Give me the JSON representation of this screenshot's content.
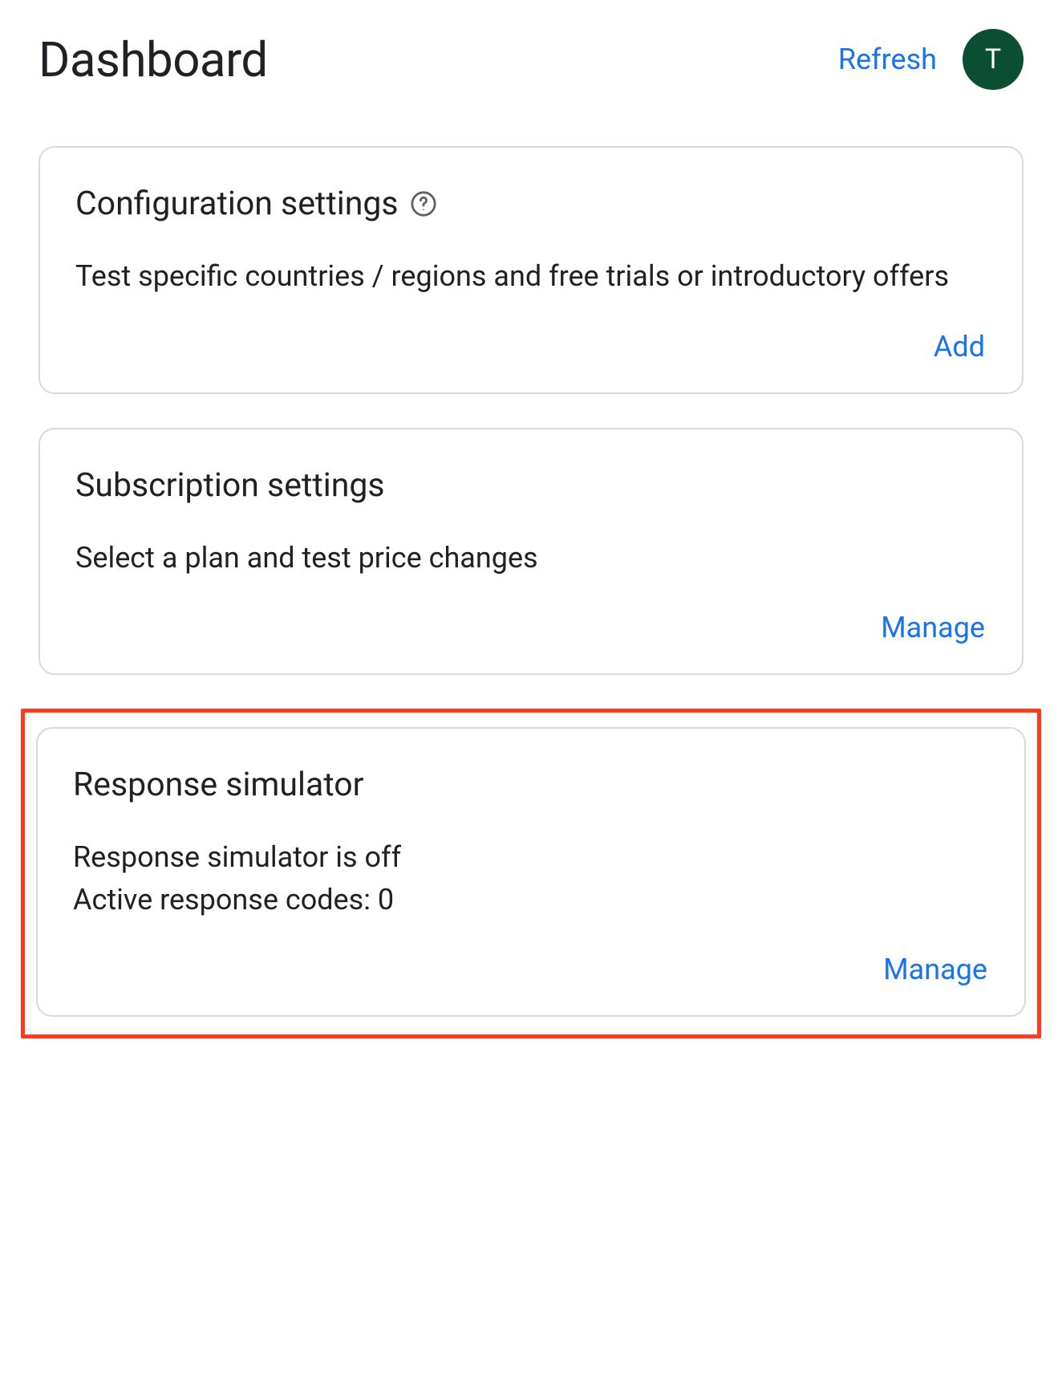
{
  "header": {
    "title": "Dashboard",
    "refresh_label": "Refresh",
    "avatar_letter": "T"
  },
  "cards": {
    "config": {
      "title": "Configuration settings",
      "desc": "Test specific countries / regions and free trials or introductory offers",
      "action": "Add"
    },
    "subscription": {
      "title": "Subscription settings",
      "desc": "Select a plan and test price changes",
      "action": "Manage"
    },
    "response": {
      "title": "Response simulator",
      "line1": "Response simulator is off",
      "line2": "Active response codes: 0",
      "action": "Manage"
    }
  }
}
